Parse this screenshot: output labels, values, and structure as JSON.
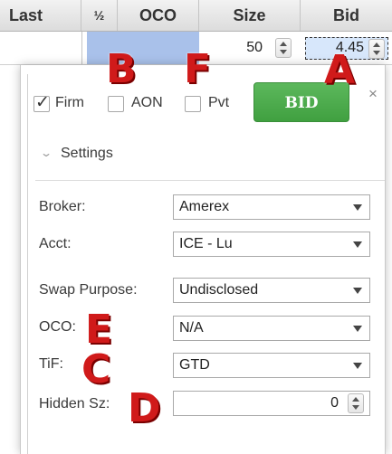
{
  "grid": {
    "columns": [
      "Last",
      "½",
      "OCO",
      "Size",
      "Bid"
    ],
    "row": {
      "size": "50",
      "bid": "4.45"
    }
  },
  "panel": {
    "checkboxes": [
      {
        "label": "Firm",
        "checked": true
      },
      {
        "label": "AON",
        "checked": false
      },
      {
        "label": "Pvt",
        "checked": false
      }
    ],
    "bid_button": "BID",
    "close": "×",
    "settings_label": "Settings",
    "fields": [
      {
        "label": "Broker:",
        "value": "Amerex"
      },
      {
        "label": "Acct:",
        "value": "ICE - Lu"
      },
      {
        "label": "Swap Purpose:",
        "value": "Undisclosed"
      },
      {
        "label": "OCO:",
        "value": "N/A"
      },
      {
        "label": "TiF:",
        "value": "GTD"
      }
    ],
    "hidden_size": {
      "label": "Hidden Sz:",
      "value": "0"
    }
  },
  "annotations": [
    "A",
    "B",
    "C",
    "D",
    "E",
    "F"
  ],
  "colors": {
    "bid_button": "#4cae4c",
    "annotation": "#d01a1a",
    "oco_cell": "#a9c1ea"
  }
}
